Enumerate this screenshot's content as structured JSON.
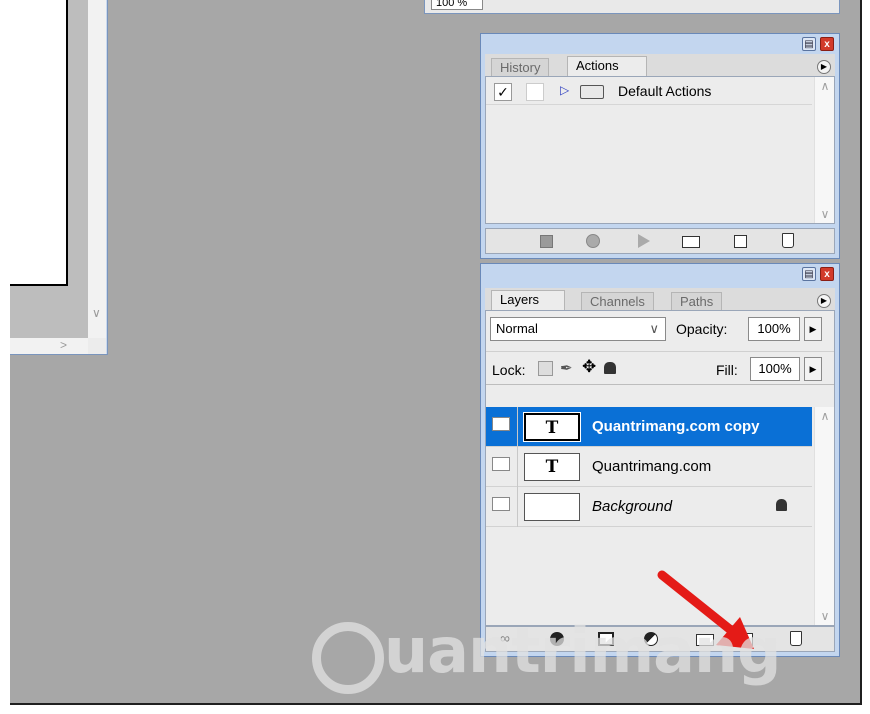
{
  "topbar": {
    "zoom_text": "100 %"
  },
  "actions_panel": {
    "tabs": [
      {
        "label": "History",
        "active": false
      },
      {
        "label": "Actions",
        "active": true
      }
    ],
    "set_name": "Default Actions",
    "toolbar_icons": [
      "stop-icon",
      "record-icon",
      "play-icon",
      "new-set-icon",
      "new-action-icon",
      "trash-icon"
    ]
  },
  "layers_panel": {
    "tabs": [
      {
        "label": "Layers",
        "active": true
      },
      {
        "label": "Channels",
        "active": false
      },
      {
        "label": "Paths",
        "active": false
      }
    ],
    "blend_mode": "Normal",
    "opacity_label": "Opacity:",
    "opacity_value": "100%",
    "lock_label": "Lock:",
    "fill_label": "Fill:",
    "fill_value": "100%",
    "layers": [
      {
        "name": "Quantrimang.com copy",
        "thumb": "T",
        "selected": true
      },
      {
        "name": "Quantrimang.com",
        "thumb": "T",
        "selected": false
      },
      {
        "name": "Background",
        "thumb": "",
        "selected": false,
        "locked": true
      }
    ],
    "toolbar_icons": [
      "link-icon",
      "layer-style-icon",
      "mask-icon",
      "adjustment-icon",
      "group-icon",
      "new-layer-icon",
      "trash-icon"
    ]
  },
  "watermark": {
    "text": "uantrimang"
  },
  "colors": {
    "selection": "#0a70d6",
    "panel_frame": "#c3d6ef",
    "workspace": "#a7a7a7",
    "arrow": "#e41b17"
  }
}
